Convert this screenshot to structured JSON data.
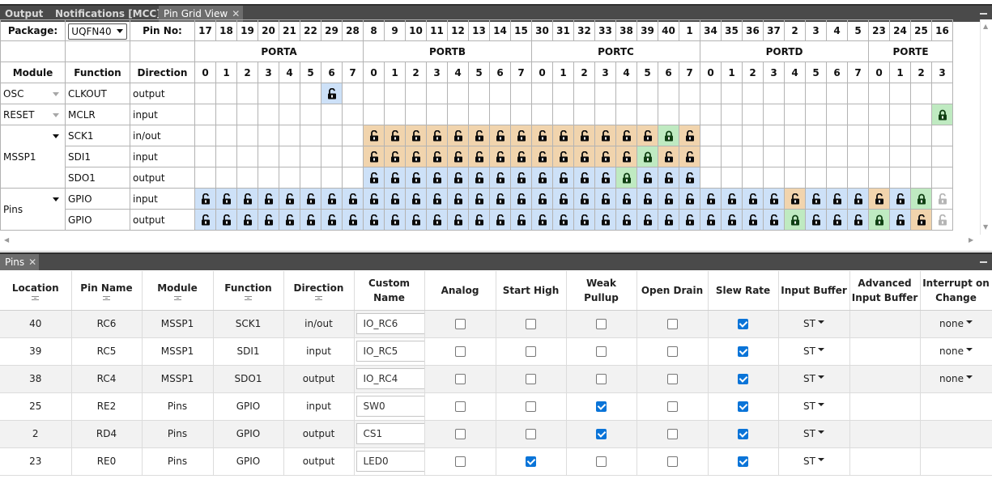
{
  "tabs_top": [
    {
      "label": "Output",
      "active": false
    },
    {
      "label": "Notifications [MCC]",
      "active": false
    },
    {
      "label": "Pin Grid View",
      "active": true
    }
  ],
  "tabs_bottom": [
    {
      "label": "Pins",
      "active": true
    }
  ],
  "close_glyph": "✕",
  "grid": {
    "package_label": "Package:",
    "package_value": "UQFN40",
    "pin_no_label": "Pin No:",
    "headers": {
      "module": "Module",
      "function": "Function",
      "direction": "Direction"
    },
    "pin_numbers": [
      "17",
      "18",
      "19",
      "20",
      "21",
      "22",
      "29",
      "28",
      "8",
      "9",
      "10",
      "11",
      "12",
      "13",
      "14",
      "15",
      "30",
      "31",
      "32",
      "33",
      "38",
      "39",
      "40",
      "1",
      "34",
      "35",
      "36",
      "37",
      "2",
      "3",
      "4",
      "5",
      "23",
      "24",
      "25",
      "16"
    ],
    "bit_numbers": [
      "0",
      "1",
      "2",
      "3",
      "4",
      "5",
      "6",
      "7",
      "0",
      "1",
      "2",
      "3",
      "4",
      "5",
      "6",
      "7",
      "0",
      "1",
      "2",
      "3",
      "4",
      "5",
      "6",
      "7",
      "0",
      "1",
      "2",
      "3",
      "4",
      "5",
      "6",
      "7",
      "0",
      "1",
      "2",
      "3"
    ],
    "ports": [
      {
        "name": "PORTA",
        "span": 8
      },
      {
        "name": "PORTB",
        "span": 8
      },
      {
        "name": "PORTC",
        "span": 8
      },
      {
        "name": "PORTD",
        "span": 8
      },
      {
        "name": "PORTE",
        "span": 4
      }
    ],
    "modules": [
      {
        "name": "OSC",
        "expanded": false,
        "rows": [
          {
            "function": "CLKOUT",
            "direction": "output",
            "cells": "......o............................."
          }
        ]
      },
      {
        "name": "RESET",
        "expanded": false,
        "rows": [
          {
            "function": "MCLR",
            "direction": "input",
            "cells": "...................................L"
          }
        ]
      },
      {
        "name": "MSSP1",
        "expanded": true,
        "rows": [
          {
            "function": "SCK1",
            "direction": "in/out",
            "cells": "........SSSSSSSSSSSSSSLS............"
          },
          {
            "function": "SDI1",
            "direction": "input",
            "cells": "........SSSSSSSSSSSSSLSS............"
          },
          {
            "function": "SDO1",
            "direction": "output",
            "cells": "........BBBBBBBBBBBBLBBB............"
          }
        ]
      },
      {
        "name": "Pins",
        "expanded": true,
        "rows": [
          {
            "function": "GPIO",
            "direction": "input",
            "cells": "BBBBBBBBBBBBBBBBBBBBBBBBBBBBSBBBSBLU"
          },
          {
            "function": "GPIO",
            "direction": "output",
            "cells": "BBBBBBBBBBBBBBBBBBBBBBBBBBBBLBBBLBSU"
          }
        ]
      }
    ]
  },
  "pins_table": {
    "columns": [
      {
        "label": "Location",
        "filter": true
      },
      {
        "label": "Pin Name",
        "filter": true
      },
      {
        "label": "Module",
        "filter": true
      },
      {
        "label": "Function",
        "filter": true
      },
      {
        "label": "Direction",
        "filter": true
      },
      {
        "label": "Custom Name",
        "filter": false
      },
      {
        "label": "Analog",
        "filter": false
      },
      {
        "label": "Start High",
        "filter": false
      },
      {
        "label": "Weak Pullup",
        "filter": false
      },
      {
        "label": "Open Drain",
        "filter": false
      },
      {
        "label": "Slew Rate",
        "filter": false
      },
      {
        "label": "Input Buffer",
        "filter": false
      },
      {
        "label": "Advanced Input Buffer",
        "filter": false
      },
      {
        "label": "Interrupt on Change",
        "filter": false
      }
    ],
    "rows": [
      {
        "location": "40",
        "pin_name": "RC6",
        "module": "MSSP1",
        "function": "SCK1",
        "direction": "in/out",
        "custom_name": "IO_RC6",
        "analog": false,
        "start_high": false,
        "weak_pullup": false,
        "open_drain": false,
        "slew_rate": true,
        "input_buffer": "ST",
        "ioc": "none"
      },
      {
        "location": "39",
        "pin_name": "RC5",
        "module": "MSSP1",
        "function": "SDI1",
        "direction": "input",
        "custom_name": "IO_RC5",
        "analog": false,
        "start_high": false,
        "weak_pullup": false,
        "open_drain": false,
        "slew_rate": true,
        "input_buffer": "ST",
        "ioc": "none"
      },
      {
        "location": "38",
        "pin_name": "RC4",
        "module": "MSSP1",
        "function": "SDO1",
        "direction": "output",
        "custom_name": "IO_RC4",
        "analog": false,
        "start_high": false,
        "weak_pullup": false,
        "open_drain": false,
        "slew_rate": true,
        "input_buffer": "ST",
        "ioc": "none"
      },
      {
        "location": "25",
        "pin_name": "RE2",
        "module": "Pins",
        "function": "GPIO",
        "direction": "input",
        "custom_name": "SW0",
        "analog": false,
        "start_high": false,
        "weak_pullup": true,
        "open_drain": false,
        "slew_rate": true,
        "input_buffer": "ST",
        "ioc": ""
      },
      {
        "location": "2",
        "pin_name": "RD4",
        "module": "Pins",
        "function": "GPIO",
        "direction": "output",
        "custom_name": "CS1",
        "analog": false,
        "start_high": false,
        "weak_pullup": true,
        "open_drain": false,
        "slew_rate": true,
        "input_buffer": "ST",
        "ioc": ""
      },
      {
        "location": "23",
        "pin_name": "RE0",
        "module": "Pins",
        "function": "GPIO",
        "direction": "output",
        "custom_name": "LED0",
        "analog": false,
        "start_high": true,
        "weak_pullup": false,
        "open_drain": false,
        "slew_rate": true,
        "input_buffer": "ST",
        "ioc": ""
      }
    ]
  },
  "colors": {
    "cell_blue": "#cde1f8",
    "cell_orange": "#f1d4ad",
    "cell_green": "#bfeac1",
    "checkbox_on": "#0a74d8",
    "tabbar": "#4a4a4a"
  },
  "icons": {
    "unlocked": "padlock-open-icon",
    "locked": "padlock-closed-icon",
    "unavailable": "padlock-grey-icon"
  }
}
